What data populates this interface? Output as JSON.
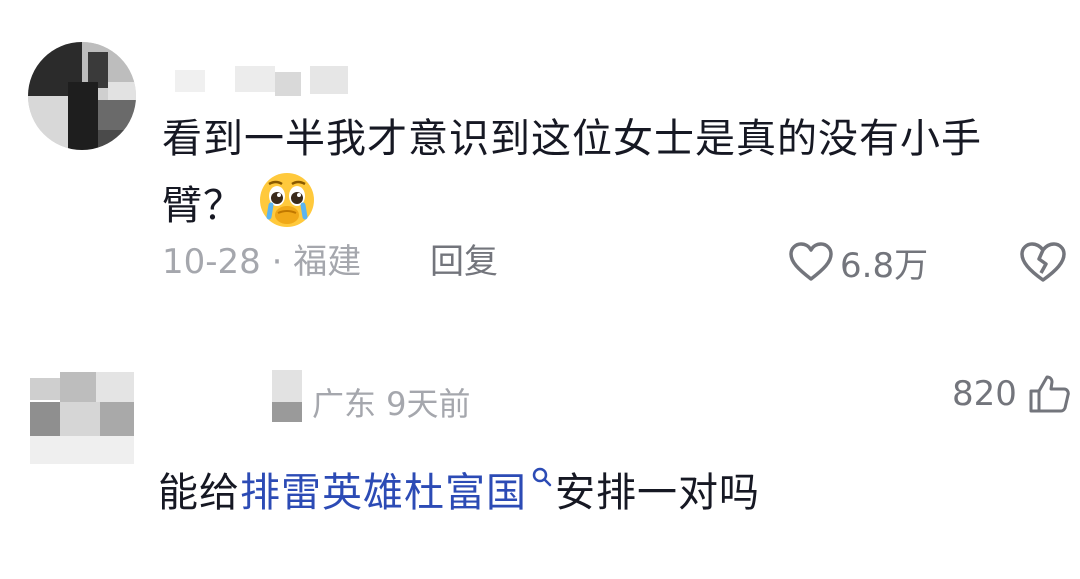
{
  "comments": [
    {
      "text": "看到一半我才意识到这位女士是真的没有小手臂？",
      "emoji": "pleading-face-emoji",
      "date_location": "10-28 · 福建",
      "reply_label": "回复",
      "likes": "6.8万"
    },
    {
      "meta": "广东 9天前",
      "text_prefix": "能给",
      "link_text": "排雷英雄杜富国",
      "text_suffix": "安排一对吗",
      "likes": "820"
    }
  ],
  "colors": {
    "primary_text": "#161823",
    "secondary_text": "#a5a7ad",
    "action_text": "#73757c",
    "link": "#2c4bb5"
  }
}
